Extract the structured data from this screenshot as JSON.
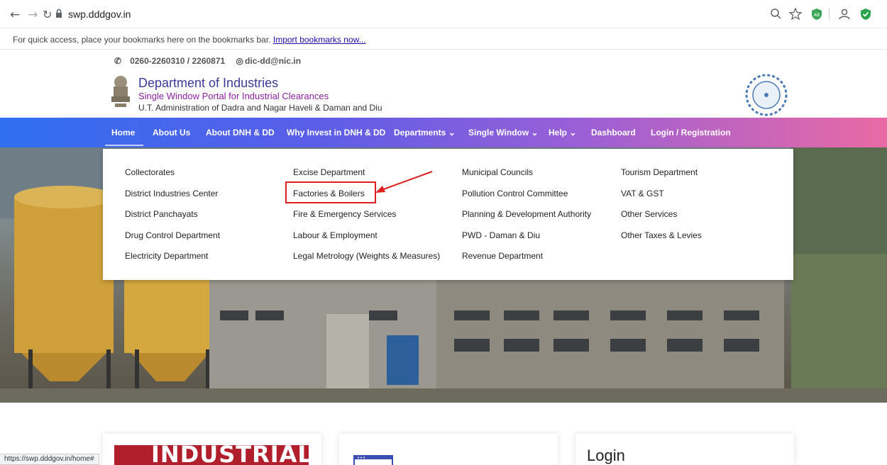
{
  "browser": {
    "url": "swp.dddgov.in",
    "bookmarks_text": "For quick access, place your bookmarks here on the bookmarks bar.",
    "bookmarks_link": "Import bookmarks now...",
    "status_url": "https://swp.dddgov.in/home#"
  },
  "contact": {
    "phone": "0260-2260310 / 2260871",
    "email": "dic-dd@nic.in"
  },
  "header": {
    "title": "Department of Industries",
    "subtitle": "Single Window Portal for Industrial Clearances",
    "subtitle2": "U.T. Administration of Dadra and Nagar Haveli & Daman and Diu"
  },
  "nav": {
    "items": [
      "Home",
      "About Us",
      "About DNH & DD",
      "Why Invest in DNH & DD",
      "Departments ⌄",
      "Single Window ⌄",
      "Help ⌄",
      "Dashboard",
      "Login / Registration"
    ]
  },
  "dropdown": {
    "col1": [
      "Collectorates",
      "District Industries Center",
      "District Panchayats",
      "Drug Control Department",
      "Electricity Department"
    ],
    "col2": [
      "Excise Department",
      "Factories & Boilers",
      "Fire & Emergency Services",
      "Labour & Employment",
      "Legal Metrology (Weights & Measures)"
    ],
    "col3": [
      "Municipal Councils",
      "Pollution Control Committee",
      "Planning & Development Authority",
      "PWD - Daman & Diu",
      "Revenue Department"
    ],
    "col4": [
      "Tourism Department",
      "VAT & GST",
      "Other Services",
      "Other Taxes & Levies"
    ]
  },
  "cards": {
    "card1_text": "INDUSTRIAL",
    "card3_title": "Login"
  },
  "colors": {
    "annotation": "#e02020",
    "nav_start": "#2f6ff0",
    "nav_end": "#e96aa4"
  }
}
